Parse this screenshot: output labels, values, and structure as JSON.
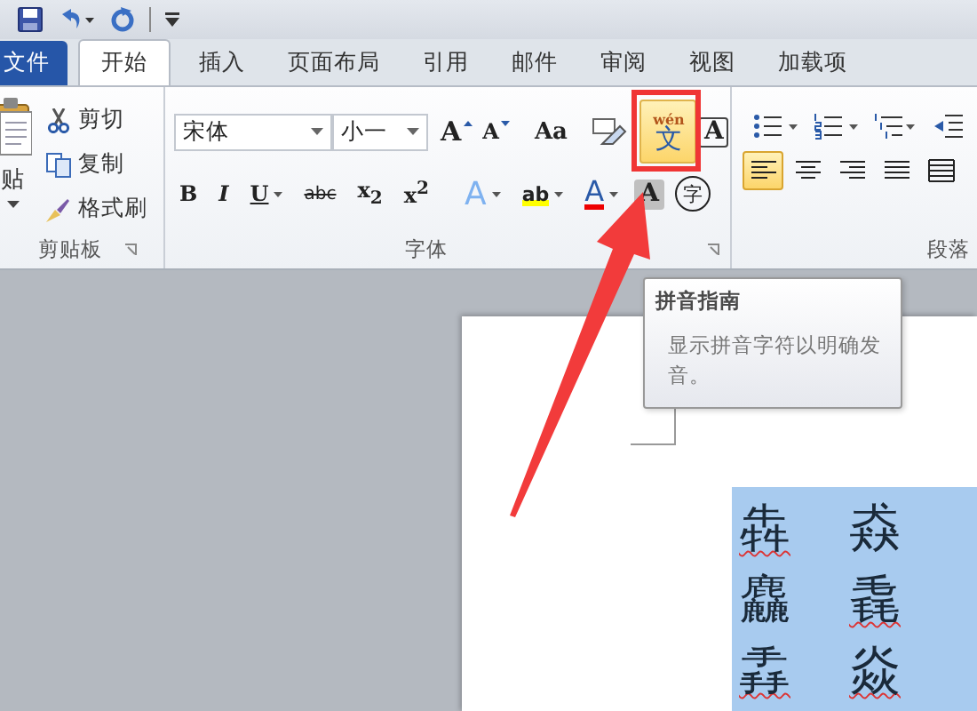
{
  "tabs": [
    {
      "label": "文件",
      "kind": "file",
      "selected": false
    },
    {
      "label": "开始",
      "kind": "tab",
      "selected": true
    },
    {
      "label": "插入",
      "kind": "tab",
      "selected": false
    },
    {
      "label": "页面布局",
      "kind": "tab",
      "selected": false
    },
    {
      "label": "引用",
      "kind": "tab",
      "selected": false
    },
    {
      "label": "邮件",
      "kind": "tab",
      "selected": false
    },
    {
      "label": "审阅",
      "kind": "tab",
      "selected": false
    },
    {
      "label": "视图",
      "kind": "tab",
      "selected": false
    },
    {
      "label": "加载项",
      "kind": "tab",
      "selected": false
    }
  ],
  "clipboard": {
    "paste_label": "贴",
    "items": [
      {
        "kind": "cut",
        "label": "剪切"
      },
      {
        "kind": "copy",
        "label": "复制"
      },
      {
        "kind": "brush",
        "label": "格式刷"
      }
    ],
    "label": "剪贴板"
  },
  "font": {
    "font_name": "宋体",
    "font_size": "小一",
    "row1": [
      {
        "kind": "grow",
        "text": "A",
        "selected": false
      },
      {
        "kind": "shrink",
        "text": "A",
        "selected": false
      },
      {
        "kind": "case",
        "text": "Aa",
        "selected": false
      },
      {
        "kind": "clear",
        "selected": false
      },
      {
        "kind": "phonetic",
        "text": "文",
        "pinyin": "wén",
        "selected": true
      },
      {
        "kind": "border",
        "text": "A",
        "selected": false
      }
    ],
    "row2": [
      {
        "kind": "bold",
        "text": "B"
      },
      {
        "kind": "italic",
        "text": "I"
      },
      {
        "kind": "underline",
        "text": "U"
      },
      {
        "kind": "strike",
        "text": "abc"
      },
      {
        "kind": "sub",
        "text": "x$_{2}$"
      },
      {
        "kind": "sup",
        "text": "x$^{2}$"
      },
      {
        "kind": "effects",
        "text": "A"
      },
      {
        "kind": "highlight",
        "text": "ab"
      },
      {
        "kind": "color",
        "text": "A"
      },
      {
        "kind": "shading",
        "text": "A"
      },
      {
        "kind": "enclose",
        "text": "字"
      }
    ],
    "label": "字体"
  },
  "paragraph": {
    "row1": [
      {
        "kind": "bullets"
      },
      {
        "kind": "numbering"
      },
      {
        "kind": "multilevel"
      },
      {
        "kind": "indent"
      }
    ],
    "row2": [
      {
        "kind": "left",
        "selected": true
      },
      {
        "kind": "center",
        "selected": false
      },
      {
        "kind": "right",
        "selected": false
      },
      {
        "kind": "justify",
        "selected": false
      },
      {
        "kind": "distributed",
        "selected": false
      }
    ],
    "label": "段落"
  },
  "tooltip": {
    "title": "拼音指南",
    "body": "显示拼音字符以明确发音。"
  },
  "document": {
    "characters": [
      {
        "char": "犇",
        "flagged": true
      },
      {
        "char": "猋",
        "flagged": false
      },
      {
        "char": "麤",
        "flagged": false
      },
      {
        "char": "毳",
        "flagged": true
      },
      {
        "char": "掱",
        "flagged": true
      },
      {
        "char": "焱",
        "flagged": true
      }
    ]
  }
}
